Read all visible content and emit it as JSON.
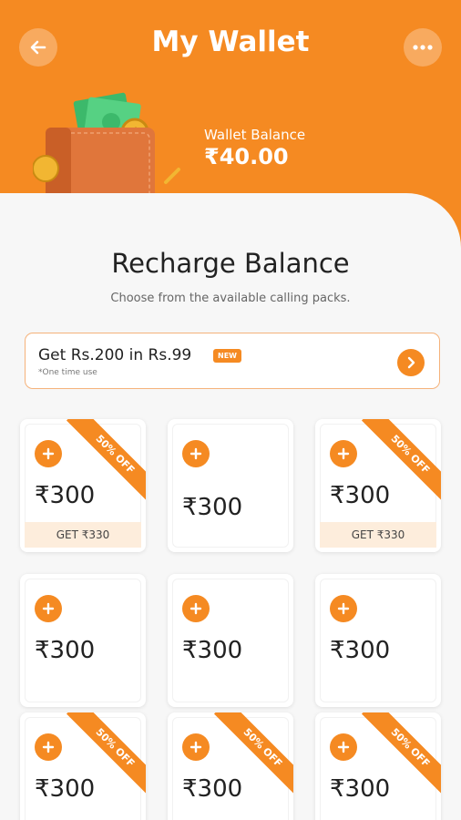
{
  "header": {
    "title": "My Wallet",
    "back_icon": "arrow-left-icon",
    "more_icon": "more-dots-icon",
    "wallet_label": "Wallet Balance",
    "wallet_balance": "₹40.00"
  },
  "recharge": {
    "title": "Recharge Balance",
    "subtitle": "Choose from the available calling packs."
  },
  "offer": {
    "text": "Get Rs.200 in Rs.99",
    "badge": "NEW",
    "note": "*One time use"
  },
  "packs": [
    {
      "amount": "₹300",
      "ribbon": "50% OFF",
      "get": "GET ₹330"
    },
    {
      "amount": "₹300"
    },
    {
      "amount": "₹300",
      "ribbon": "50% OFF",
      "get": "GET ₹330"
    },
    {
      "amount": "₹300"
    },
    {
      "amount": "₹300"
    },
    {
      "amount": "₹300"
    },
    {
      "amount": "₹300",
      "ribbon": "50% OFF"
    },
    {
      "amount": "₹300",
      "ribbon": "50% OFF"
    },
    {
      "amount": "₹300",
      "ribbon": "50% OFF"
    }
  ],
  "colors": {
    "accent": "#f58a22",
    "strip": "#fdeddc"
  }
}
